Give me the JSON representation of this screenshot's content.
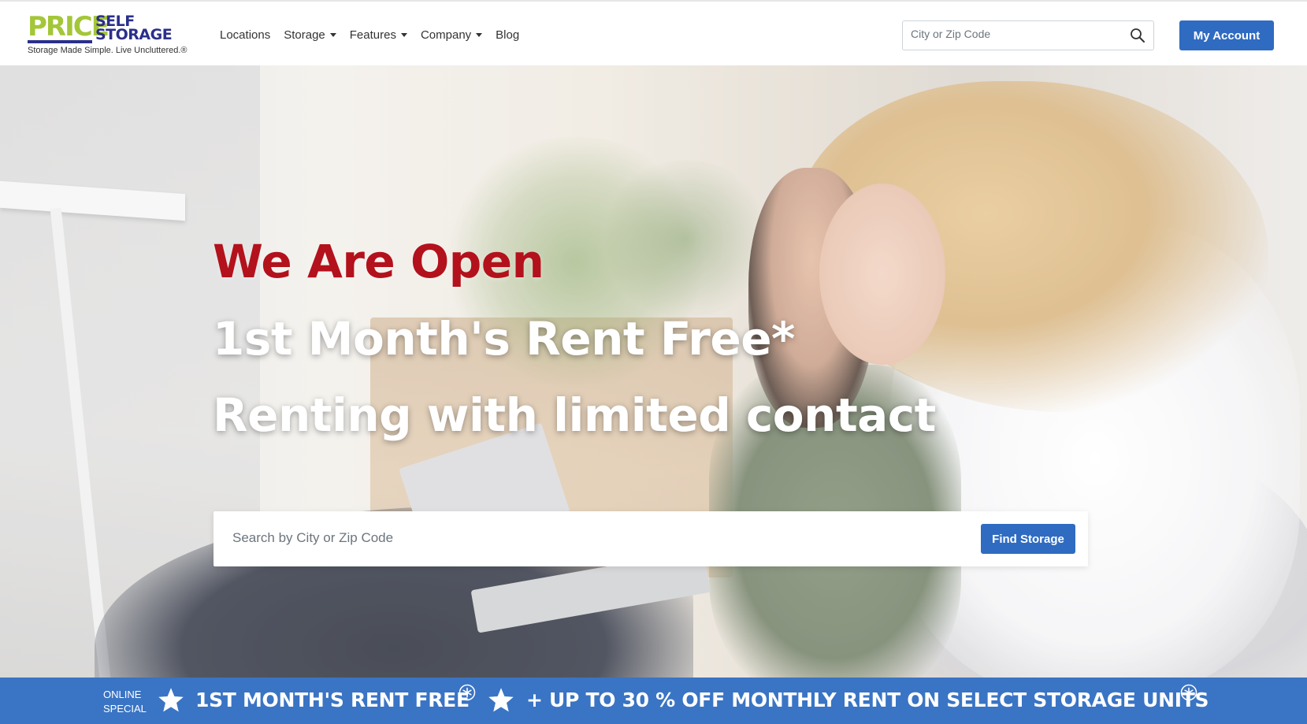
{
  "header": {
    "logo": {
      "price": "PRICE",
      "self": "SELF",
      "storage": "STORAGE",
      "tagline": "Storage Made Simple. Live Uncluttered.®"
    },
    "nav": [
      {
        "label": "Locations",
        "has_dropdown": false
      },
      {
        "label": "Storage",
        "has_dropdown": true
      },
      {
        "label": "Features",
        "has_dropdown": true
      },
      {
        "label": "Company",
        "has_dropdown": true
      },
      {
        "label": "Blog",
        "has_dropdown": false
      }
    ],
    "search": {
      "placeholder": "City or Zip Code",
      "icon": "search-icon"
    },
    "account_label": "My Account"
  },
  "hero": {
    "line1": "We Are Open",
    "line2": "1st Month's Rent Free*",
    "line3": "Renting with limited contact",
    "search_placeholder": "Search by City or Zip Code",
    "find_label": "Find Storage"
  },
  "promo": {
    "label_line1": "ONLINE",
    "label_line2": "SPECIAL",
    "offer1": "1ST MONTH'S RENT FREE",
    "offer2": "+ UP TO 30 % OFF MONTHLY RENT ON SELECT STORAGE UNITS"
  },
  "colors": {
    "accent_blue": "#2f6bc1",
    "promo_blue": "#3a74c4",
    "headline_red": "#b3111c",
    "logo_green": "#a4c639",
    "logo_navy": "#2b2f8a"
  }
}
